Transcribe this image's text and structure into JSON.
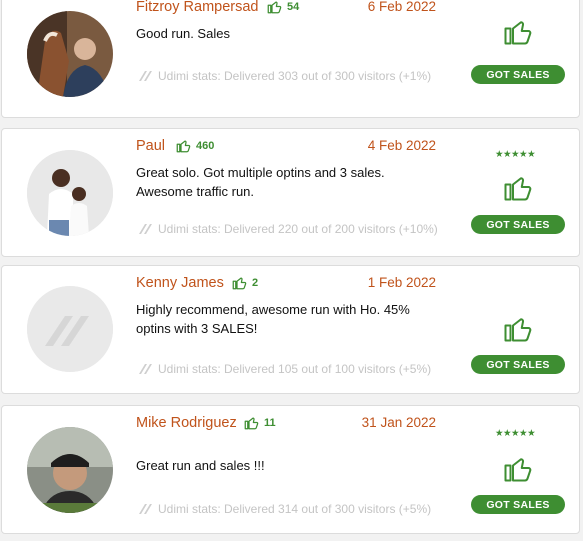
{
  "colors": {
    "accent_orange": "#c0531b",
    "green": "#3e8e32"
  },
  "reviews": [
    {
      "name": "Fitzroy Rampersad",
      "kudos": "54",
      "date": "6 Feb 2022",
      "text": "Good run. Sales",
      "stats": "Udimi stats: Delivered 303 out of 300 visitors (+1%)",
      "stars": "",
      "button": "GOT SALES",
      "avatar": "photo"
    },
    {
      "name": "Paul",
      "kudos": "460",
      "date": "4 Feb 2022",
      "text": "Great solo. Got multiple optins and 3 sales. Awesome traffic run.",
      "stats": "Udimi stats: Delivered 220 out of 200 visitors (+10%)",
      "stars": "★★★★★",
      "button": "GOT SALES",
      "avatar": "photo"
    },
    {
      "name": "Kenny James",
      "kudos": "2",
      "date": "1 Feb 2022",
      "text": "Highly recommend, awesome run with Ho. 45% optins with 3 SALES!",
      "stats": "Udimi stats: Delivered 105 out of 100 visitors (+5%)",
      "stars": "",
      "button": "GOT SALES",
      "avatar": "placeholder-logo"
    },
    {
      "name": "Mike Rodriguez",
      "kudos": "11",
      "date": "31 Jan 2022",
      "text": "Great run and sales !!!",
      "stats": "Udimi stats: Delivered 314 out of 300 visitors (+5%)",
      "stars": "★★★★★",
      "button": "GOT SALES",
      "avatar": "photo"
    }
  ]
}
